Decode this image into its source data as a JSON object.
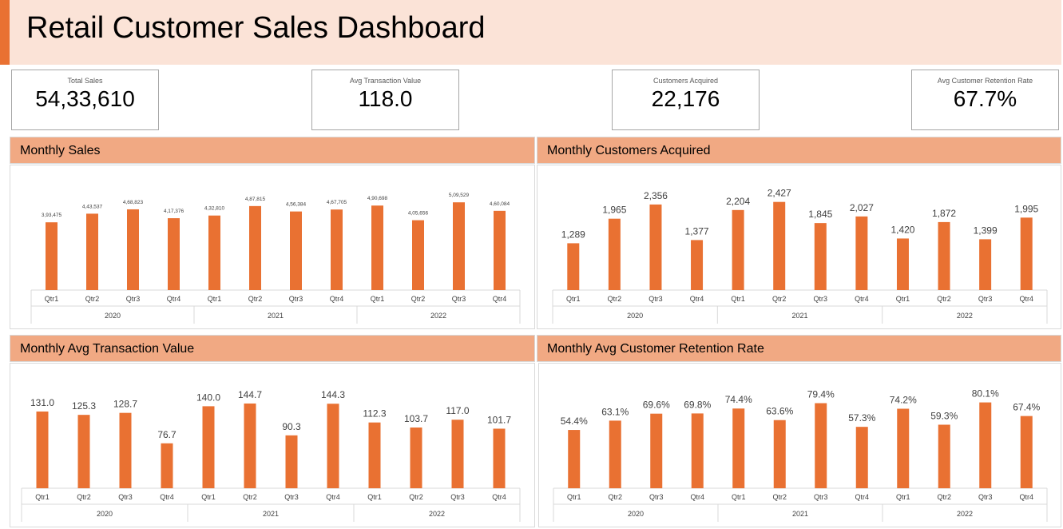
{
  "header": {
    "title": "Retail Customer Sales Dashboard"
  },
  "colors": {
    "accent": "#e97132",
    "header_bg": "#fbe3d7",
    "panel_header": "#f1a983"
  },
  "kpis": [
    {
      "label": "Total Sales",
      "value": "54,33,610"
    },
    {
      "label": "Avg Transaction Value",
      "value": "118.0"
    },
    {
      "label": "Customers Acquired",
      "value": "22,176"
    },
    {
      "label": "Avg Customer Retention Rate",
      "value": "67.7%"
    }
  ],
  "panels": [
    {
      "title": "Monthly Sales"
    },
    {
      "title": "Monthly Customers Acquired"
    },
    {
      "title": "Monthly Avg Transaction Value"
    },
    {
      "title": "Monthly Avg Customer Retention Rate"
    }
  ],
  "chart_data": [
    {
      "type": "bar",
      "categories": [
        "Qtr1",
        "Qtr2",
        "Qtr3",
        "Qtr4",
        "Qtr1",
        "Qtr2",
        "Qtr3",
        "Qtr4",
        "Qtr1",
        "Qtr2",
        "Qtr3",
        "Qtr4"
      ],
      "groups": [
        "2020",
        "2021",
        "2022"
      ],
      "values": [
        393475,
        443537,
        468823,
        417376,
        432810,
        487815,
        456384,
        467705,
        490698,
        405656,
        509529,
        460084
      ],
      "labels": [
        "3,93,475",
        "4,43,537",
        "4,68,823",
        "4,17,376",
        "4,32,810",
        "4,87,815",
        "4,56,384",
        "4,67,705",
        "4,90,698",
        "4,05,656",
        "5,09,529",
        "4,60,084"
      ],
      "ylim": [
        0,
        580000
      ]
    },
    {
      "type": "bar",
      "categories": [
        "Qtr1",
        "Qtr2",
        "Qtr3",
        "Qtr4",
        "Qtr1",
        "Qtr2",
        "Qtr3",
        "Qtr4",
        "Qtr1",
        "Qtr2",
        "Qtr3",
        "Qtr4"
      ],
      "groups": [
        "2020",
        "2021",
        "2022"
      ],
      "values": [
        1289,
        1965,
        2356,
        1377,
        2204,
        2427,
        1845,
        2027,
        1420,
        1872,
        1399,
        1995
      ],
      "labels": [
        "1,289",
        "1,965",
        "2,356",
        "1,377",
        "2,204",
        "2,427",
        "1,845",
        "2,027",
        "1,420",
        "1,872",
        "1,399",
        "1,995"
      ],
      "ylim": [
        0,
        2750
      ]
    },
    {
      "type": "bar",
      "categories": [
        "Qtr1",
        "Qtr2",
        "Qtr3",
        "Qtr4",
        "Qtr1",
        "Qtr2",
        "Qtr3",
        "Qtr4",
        "Qtr1",
        "Qtr2",
        "Qtr3",
        "Qtr4"
      ],
      "groups": [
        "2020",
        "2021",
        "2022"
      ],
      "values": [
        131.0,
        125.3,
        128.7,
        76.7,
        140.0,
        144.7,
        90.3,
        144.3,
        112.3,
        103.7,
        117.0,
        101.7
      ],
      "labels": [
        "131.0",
        "125.3",
        "128.7",
        "76.7",
        "140.0",
        "144.7",
        "90.3",
        "144.3",
        "112.3",
        "103.7",
        "117.0",
        "101.7"
      ],
      "ylim": [
        0,
        161
      ]
    },
    {
      "type": "bar",
      "categories": [
        "Qtr1",
        "Qtr2",
        "Qtr3",
        "Qtr4",
        "Qtr1",
        "Qtr2",
        "Qtr3",
        "Qtr4",
        "Qtr1",
        "Qtr2",
        "Qtr3",
        "Qtr4"
      ],
      "groups": [
        "2020",
        "2021",
        "2022"
      ],
      "values": [
        54.4,
        63.1,
        69.6,
        69.8,
        74.4,
        63.6,
        79.4,
        57.3,
        74.2,
        59.3,
        80.1,
        67.4
      ],
      "labels": [
        "54.4%",
        "63.1%",
        "69.6%",
        "69.8%",
        "74.4%",
        "63.6%",
        "79.4%",
        "57.3%",
        "74.2%",
        "59.3%",
        "80.1%",
        "67.4%"
      ],
      "ylim": [
        0,
        88
      ]
    }
  ]
}
